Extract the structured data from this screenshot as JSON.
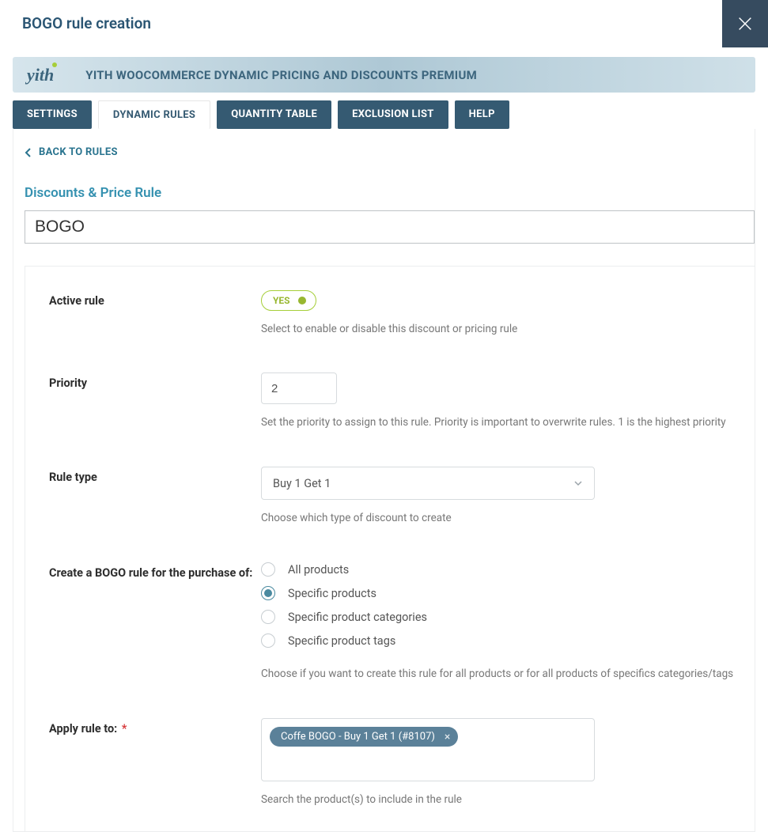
{
  "modal": {
    "title": "BOGO rule creation"
  },
  "banner": {
    "logo_text": "yith",
    "title": "YITH WOOCOMMERCE DYNAMIC PRICING AND DISCOUNTS PREMIUM"
  },
  "tabs": {
    "settings": "SETTINGS",
    "dynamic_rules": "DYNAMIC RULES",
    "quantity_table": "QUANTITY TABLE",
    "exclusion_list": "EXCLUSION LIST",
    "help": "HELP"
  },
  "back_link": "BACK TO RULES",
  "section_title": "Discounts & Price Rule",
  "rule_name": "BOGO",
  "fields": {
    "active": {
      "label": "Active rule",
      "toggle_text": "YES",
      "help": "Select to enable or disable this discount or pricing rule"
    },
    "priority": {
      "label": "Priority",
      "value": "2",
      "help": "Set the priority to assign to this rule. Priority is important to overwrite rules. 1 is the highest priority"
    },
    "rule_type": {
      "label": "Rule type",
      "selected": "Buy 1 Get 1",
      "help": "Choose which type of discount to create"
    },
    "bogo_for": {
      "label": "Create a BOGO rule for the purchase of:",
      "options": [
        "All products",
        "Specific products",
        "Specific product categories",
        "Specific product tags"
      ],
      "selected_index": 1,
      "help": "Choose if you want to create this rule for all products or for all products of specifics categories/tags"
    },
    "apply_to": {
      "label": "Apply rule to:",
      "required_mark": "*",
      "chip": "Coffe BOGO - Buy 1 Get 1 (#8107)",
      "help": "Search the product(s) to include in the rule"
    }
  }
}
